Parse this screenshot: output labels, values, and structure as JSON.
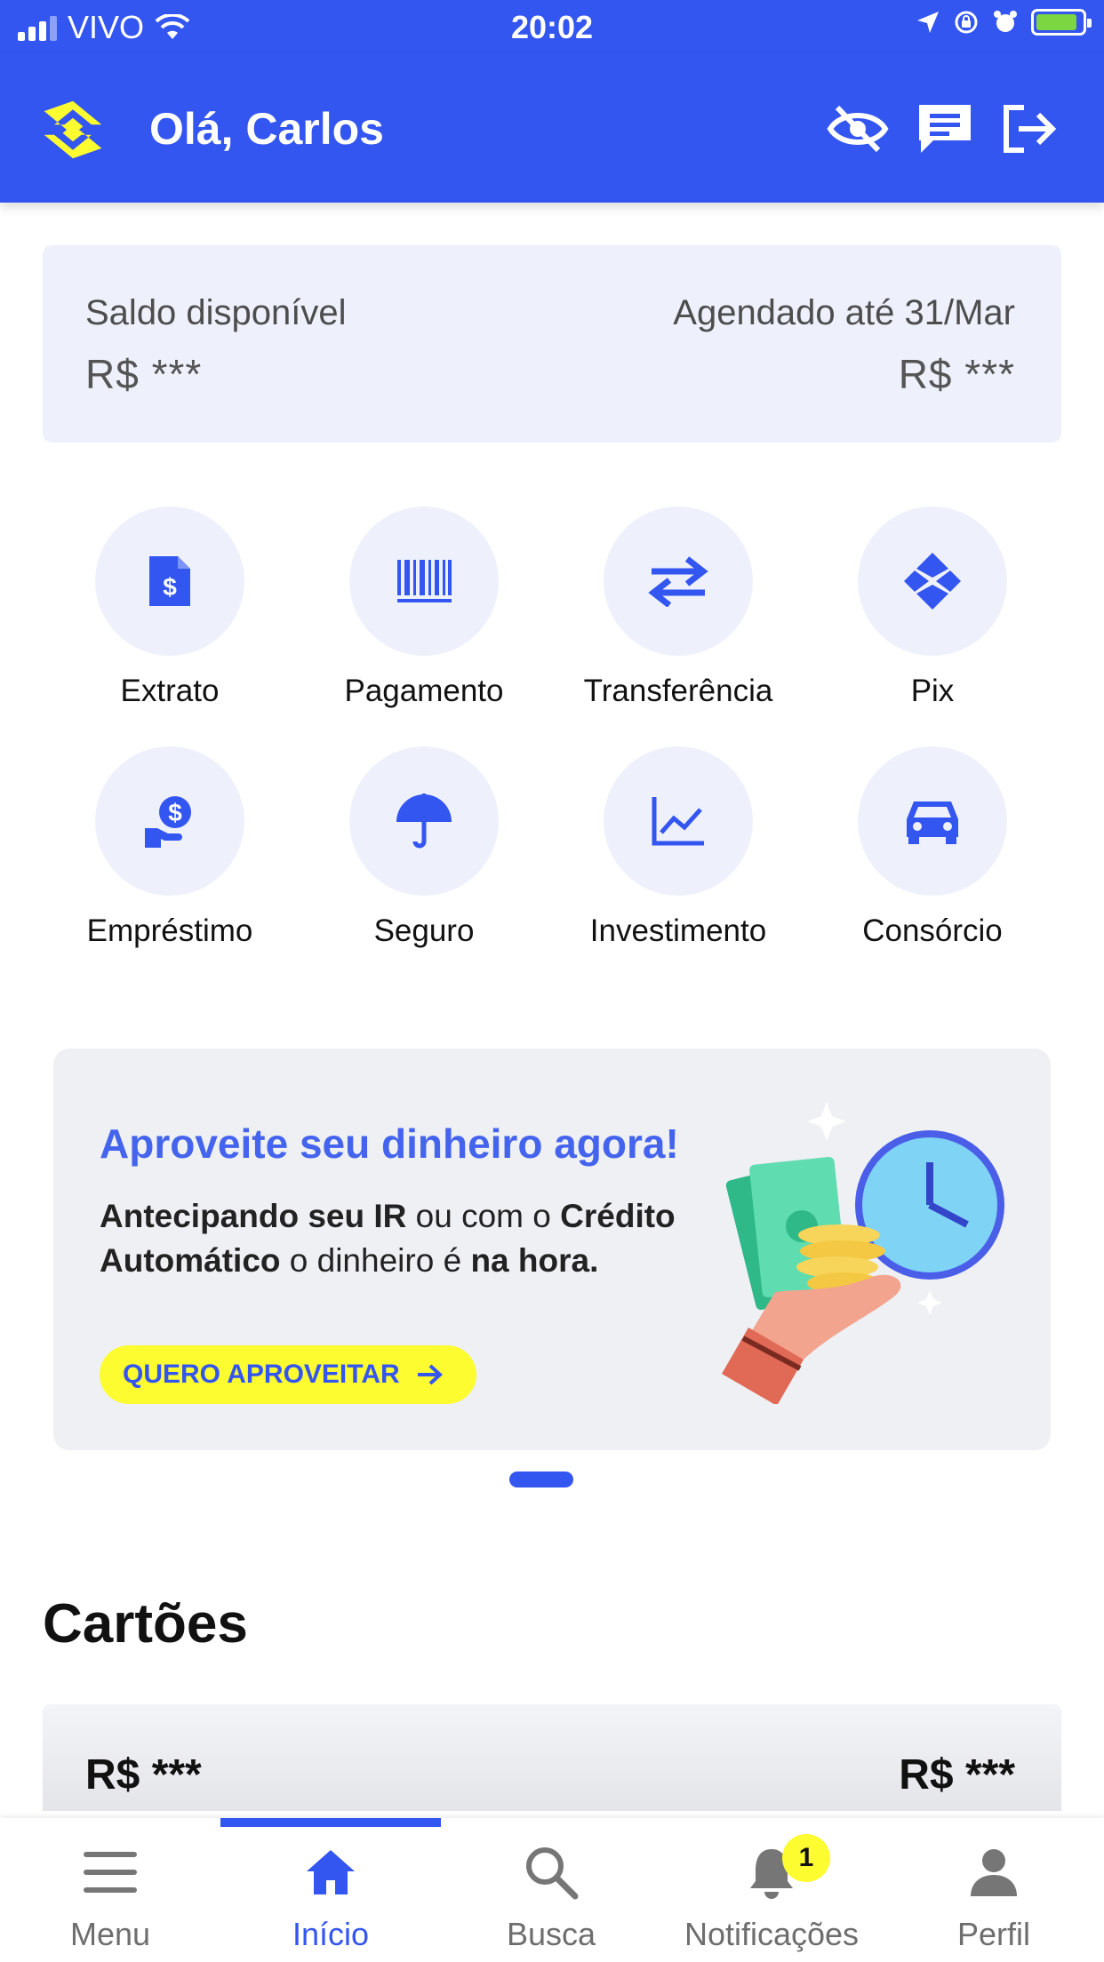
{
  "status_bar": {
    "carrier": "VIVO",
    "time": "20:02"
  },
  "header": {
    "greeting": "Olá, Carlos",
    "icons": [
      "hide-balance-icon",
      "chat-icon",
      "logout-icon"
    ]
  },
  "balance": {
    "available_label": "Saldo disponível",
    "available_value": "R$ ***",
    "scheduled_label": "Agendado até 31/Mar",
    "scheduled_value": "R$ ***"
  },
  "actions": [
    {
      "label": "Extrato",
      "icon": "statement-icon"
    },
    {
      "label": "Pagamento",
      "icon": "barcode-icon"
    },
    {
      "label": "Transferência",
      "icon": "transfer-arrows-icon"
    },
    {
      "label": "Pix",
      "icon": "pix-icon"
    },
    {
      "label": "Empréstimo",
      "icon": "loan-icon"
    },
    {
      "label": "Seguro",
      "icon": "umbrella-icon"
    },
    {
      "label": "Investimento",
      "icon": "chart-line-icon"
    },
    {
      "label": "Consórcio",
      "icon": "car-icon"
    }
  ],
  "promo": {
    "title": "Aproveite seu dinheiro agora!",
    "body_bold_1": "Antecipando seu IR",
    "body_text_1": " ou com o ",
    "body_bold_2": "Crédito Automático",
    "body_text_2": " o dinheiro é ",
    "body_bold_3": "na hora.",
    "button_label": "QUERO APROVEITAR",
    "page_indicator": "1"
  },
  "cards_section": {
    "title": "Cartões",
    "left_amount": "R$ ***",
    "right_amount": "R$ ***"
  },
  "bottom_nav": {
    "items": [
      {
        "label": "Menu"
      },
      {
        "label": "Início"
      },
      {
        "label": "Busca"
      },
      {
        "label": "Notificações",
        "badge": "1"
      },
      {
        "label": "Perfil"
      }
    ],
    "active_index": 1
  },
  "colors": {
    "brand_blue": "#3355f0",
    "brand_yellow": "#fcfc30",
    "tile_bg": "#eef1fc"
  }
}
